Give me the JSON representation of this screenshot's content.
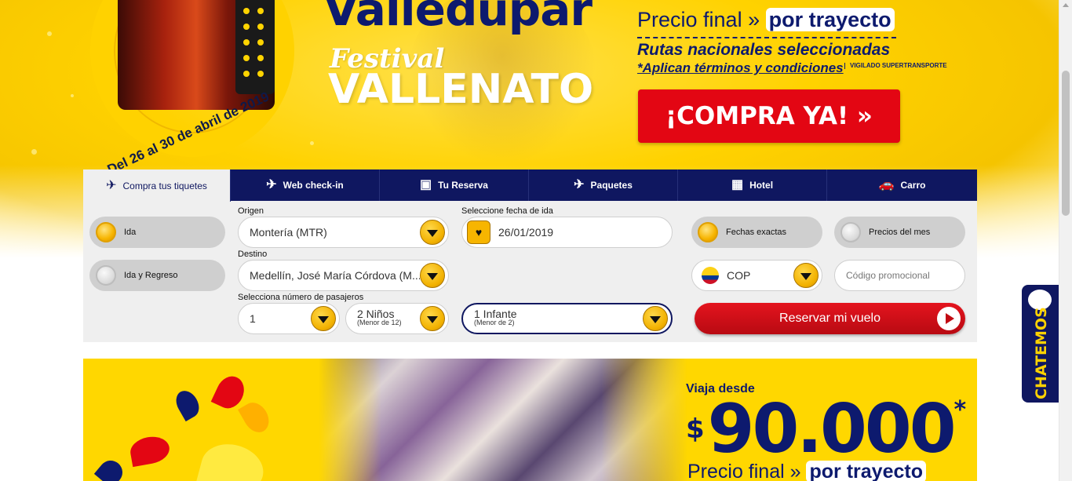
{
  "hero": {
    "title": "Valledupar",
    "festival": "Festival",
    "event": "VALLENATO",
    "dates": "Del 26 al 30 de abril de 2019",
    "price_line": "Precio final »",
    "price_tag": "por trayecto",
    "routes": "Rutas nacionales seleccionadas",
    "terms": "*Aplican términos y condiciones",
    "vigilado": "VIGILADO SUPERTRANSPORTE",
    "buy_button": "¡COMPRA YA!  »"
  },
  "tabs": [
    {
      "label": "Compra tus tiquetes",
      "icon": "plane-cloud-icon",
      "glyph": "✈"
    },
    {
      "label": "Web check-in",
      "icon": "plane-cloud-icon",
      "glyph": "✈"
    },
    {
      "label": "Tu Reserva",
      "icon": "reservation-icon",
      "glyph": "▣"
    },
    {
      "label": "Paquetes",
      "icon": "plane-building-icon",
      "glyph": "✈"
    },
    {
      "label": "Hotel",
      "icon": "hotel-icon",
      "glyph": "▦"
    },
    {
      "label": "Carro",
      "icon": "car-icon",
      "glyph": "🚗"
    }
  ],
  "trip_type": {
    "one_way": "Ida",
    "round_trip": "Ida y Regreso"
  },
  "origin": {
    "label": "Origen",
    "value": "Montería (MTR)"
  },
  "destination": {
    "label": "Destino",
    "value": "Medellín, José María Córdova (M..."
  },
  "date": {
    "label": "Seleccione fecha de ida",
    "value": "26/01/2019"
  },
  "date_mode": {
    "exact": "Fechas exactas",
    "month": "Precios del mes"
  },
  "currency": {
    "value": "COP"
  },
  "promo_code": {
    "placeholder": "Código promocional"
  },
  "passengers": {
    "label": "Selecciona número de pasajeros",
    "adults": "1",
    "children": "2 Niños",
    "children_sub": "(Menor de 12)",
    "infants": "1 Infante",
    "infants_sub": "(Menor de 2)"
  },
  "submit": "Reservar mi vuelo",
  "promo": {
    "from": "Viaja desde",
    "currency": "$",
    "amount": "90.000",
    "asterisk": "*",
    "price_line": "Precio final »",
    "price_tag": "por trayecto"
  },
  "chat": {
    "label": "CHATEMOS"
  }
}
